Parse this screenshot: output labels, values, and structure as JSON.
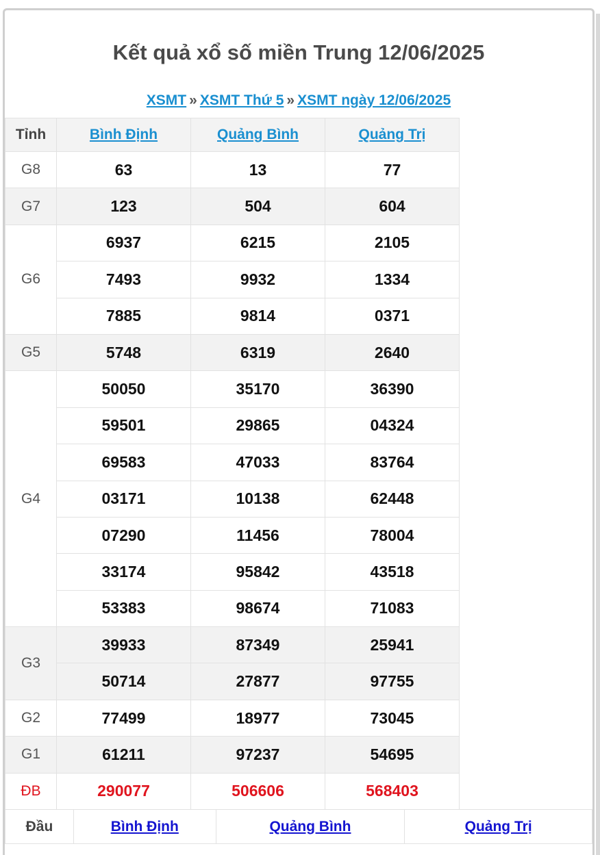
{
  "page": {
    "title": "Kết quả xổ số miền Trung 12/06/2025",
    "breadcrumb": [
      "XSMT",
      "XSMT Thứ 5",
      "XSMT ngày 12/06/2025"
    ],
    "breadcrumb_separator": "»"
  },
  "results": {
    "header_label": "Tỉnh",
    "provinces": [
      "Bình Định",
      "Quảng Bình",
      "Quảng Trị"
    ],
    "prizes": {
      "g8": {
        "label": "G8",
        "rows": [
          [
            "63",
            "13",
            "77"
          ]
        ]
      },
      "g7": {
        "label": "G7",
        "rows": [
          [
            "123",
            "504",
            "604"
          ]
        ]
      },
      "g6": {
        "label": "G6",
        "rows": [
          [
            "6937",
            "6215",
            "2105"
          ],
          [
            "7493",
            "9932",
            "1334"
          ],
          [
            "7885",
            "9814",
            "0371"
          ]
        ]
      },
      "g5": {
        "label": "G5",
        "rows": [
          [
            "5748",
            "6319",
            "2640"
          ]
        ]
      },
      "g4": {
        "label": "G4",
        "rows": [
          [
            "50050",
            "35170",
            "36390"
          ],
          [
            "59501",
            "29865",
            "04324"
          ],
          [
            "69583",
            "47033",
            "83764"
          ],
          [
            "03171",
            "10138",
            "62448"
          ],
          [
            "07290",
            "11456",
            "78004"
          ],
          [
            "33174",
            "95842",
            "43518"
          ],
          [
            "53383",
            "98674",
            "71083"
          ]
        ]
      },
      "g3": {
        "label": "G3",
        "rows": [
          [
            "39933",
            "87349",
            "25941"
          ],
          [
            "50714",
            "27877",
            "97755"
          ]
        ]
      },
      "g2": {
        "label": "G2",
        "rows": [
          [
            "77499",
            "18977",
            "73045"
          ]
        ]
      },
      "g1": {
        "label": "G1",
        "rows": [
          [
            "61211",
            "97237",
            "54695"
          ]
        ]
      },
      "db": {
        "label": "ĐB",
        "rows": [
          [
            "290077",
            "506606",
            "568403"
          ]
        ]
      }
    },
    "special_color": "#e0141e",
    "link_color": "#1a8fd0"
  },
  "dau_table": {
    "header_label": "Đầu",
    "provinces": [
      "Bình Định",
      "Quảng Bình",
      "Quảng Trị"
    ]
  }
}
